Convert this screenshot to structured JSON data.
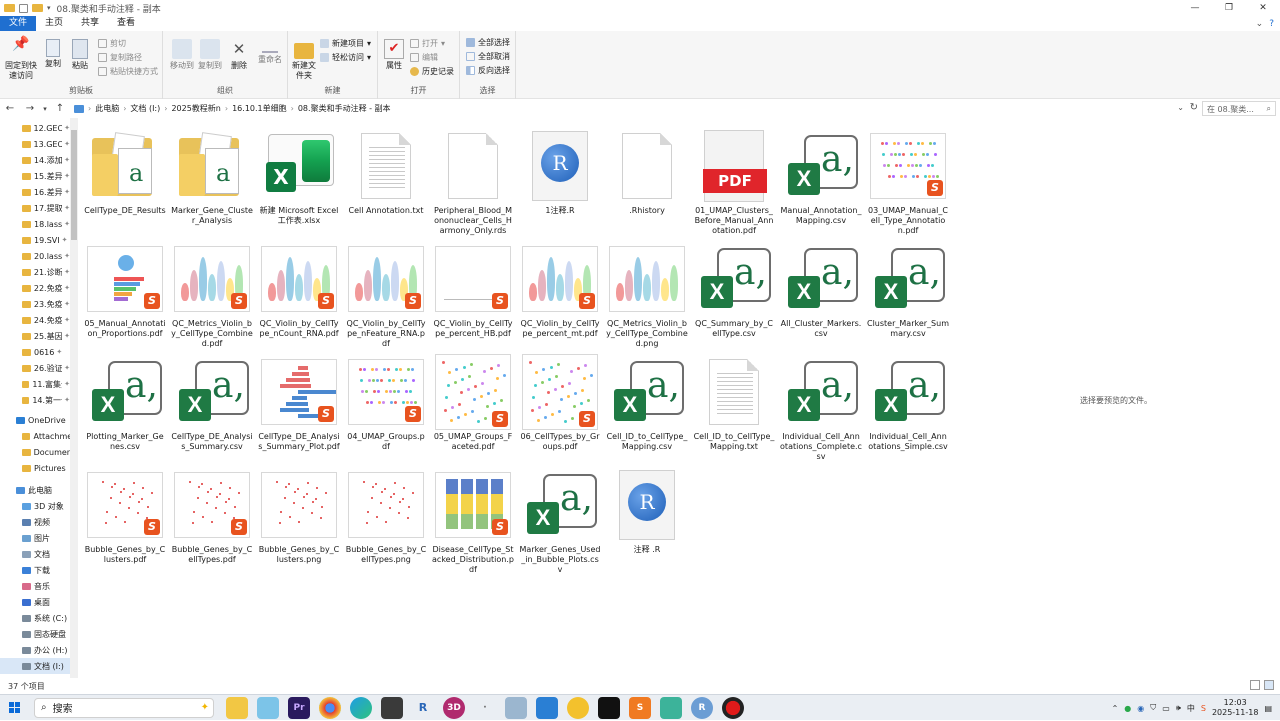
{
  "window": {
    "title": "08.聚类和手动注释 - 副本",
    "controls": [
      "—",
      "❐",
      "✕"
    ]
  },
  "ribbon_tabs": [
    "文件",
    "主页",
    "共享",
    "查看"
  ],
  "ribbon": {
    "clipboard": {
      "pin_label": "固定到快速访问",
      "copy_label": "复制",
      "paste_label": "粘贴",
      "cut_label": "剪切",
      "copypath_label": "复制路径",
      "pasteshortcut_label": "粘贴快捷方式",
      "group_label": "剪贴板"
    },
    "organize": {
      "moveto_label": "移动到",
      "copyto_label": "复制到",
      "delete_label": "删除",
      "rename_label": "重命名",
      "group_label": "组织"
    },
    "new": {
      "newfolder_label": "新建文件夹",
      "newitem_label": "新建项目",
      "easyaccess_label": "轻松访问",
      "group_label": "新建"
    },
    "open": {
      "properties_label": "属性",
      "open_label": "打开",
      "edit_label": "编辑",
      "history_label": "历史记录",
      "group_label": "打开"
    },
    "select": {
      "selectall_label": "全部选择",
      "selectnone_label": "全部取消",
      "invert_label": "反向选择",
      "group_label": "选择"
    }
  },
  "address": {
    "crumbs": [
      "此电脑",
      "文档 (I:)",
      "2025教程新n",
      "16.10.1单细胞",
      "08.聚类和手动注释 - 副本"
    ],
    "search_placeholder": "在 08.聚类..."
  },
  "nav": {
    "quick": [
      "12.GEO",
      "13.GEO",
      "14.添加",
      "15.差异",
      "16.差异",
      "17.提取",
      "18.lass",
      "19.SVI",
      "20.lass",
      "21.诊断",
      "22.免疫",
      "23.免疫",
      "24.免疫",
      "25.基因",
      "0616",
      "26.验证",
      "11.富集分",
      "14.第一个"
    ],
    "onedrive": "OneDrive",
    "onedrive_items": [
      "Attachme",
      "Documen",
      "Pictures"
    ],
    "thispc": "此电脑",
    "pc_items": [
      "3D 对象",
      "视频",
      "图片",
      "文档",
      "下载",
      "音乐",
      "桌面",
      "系统 (C:)",
      "固态硬盘",
      "办公 (H:)",
      "文档 (I:)"
    ]
  },
  "files": [
    {
      "name": "CellType_DE_Results",
      "icon": "folder"
    },
    {
      "name": "Marker_Gene_Cluster_Analysis",
      "icon": "folder"
    },
    {
      "name": "新建 Microsoft Excel 工作表.xlsx",
      "icon": "excel-new"
    },
    {
      "name": "Cell Annotation.txt",
      "icon": "text"
    },
    {
      "name": "Peripheral_Blood_Mononuclear_Cells_Harmony_Only.rds",
      "icon": "blank"
    },
    {
      "name": "1注释.R",
      "icon": "r"
    },
    {
      "name": ".Rhistory",
      "icon": "blank"
    },
    {
      "name": "01_UMAP_Clusters_Before_Manual_Annotation.pdf",
      "icon": "pdf"
    },
    {
      "name": "Manual_Annotation_Mapping.csv",
      "icon": "csv"
    },
    {
      "name": "03_UMAP_Manual_Cell_Type_Annotation.pdf",
      "icon": "umap-pdf"
    },
    {
      "name": "05_Manual_Annotation_Proportions.pdf",
      "icon": "prop-pdf"
    },
    {
      "name": "QC_Metrics_Violin_by_CellType_Combined.pdf",
      "icon": "violin-pdf"
    },
    {
      "name": "QC_Violin_by_CellType_nCount_RNA.pdf",
      "icon": "violin-pdf"
    },
    {
      "name": "QC_Violin_by_CellType_nFeature_RNA.pdf",
      "icon": "violin-pdf"
    },
    {
      "name": "QC_Violin_by_CellType_percent_HB.pdf",
      "icon": "blankplot-pdf"
    },
    {
      "name": "QC_Violin_by_CellType_percent_mt.pdf",
      "icon": "violin-pdf"
    },
    {
      "name": "QC_Metrics_Violin_by_CellType_Combined.png",
      "icon": "violin-png"
    },
    {
      "name": "QC_Summary_by_CellType.csv",
      "icon": "csv"
    },
    {
      "name": "All_Cluster_Markers.csv",
      "icon": "csv"
    },
    {
      "name": "Cluster_Marker_Summary.csv",
      "icon": "csv"
    },
    {
      "name": "Plotting_Marker_Genes.csv",
      "icon": "csv"
    },
    {
      "name": "CellType_DE_Analysis_Summary.csv",
      "icon": "csv"
    },
    {
      "name": "CellType_DE_Analysis_Summary_Plot.pdf",
      "icon": "barh-pdf"
    },
    {
      "name": "04_UMAP_Groups.pdf",
      "icon": "umap-pdf"
    },
    {
      "name": "05_UMAP_Groups_Faceted.pdf",
      "icon": "facet-pdf"
    },
    {
      "name": "06_CellTypes_by_Groups.pdf",
      "icon": "facet-pdf"
    },
    {
      "name": "Cell_ID_to_CellType_Mapping.csv",
      "icon": "csv"
    },
    {
      "name": "Cell_ID_to_CellType_Mapping.txt",
      "icon": "text"
    },
    {
      "name": "Individual_Cell_Annotations_Complete.csv",
      "icon": "csv"
    },
    {
      "name": "Individual_Cell_Annotations_Simple.csv",
      "icon": "csv"
    },
    {
      "name": "Bubble_Genes_by_Clusters.pdf",
      "icon": "bubble-pdf"
    },
    {
      "name": "Bubble_Genes_by_CellTypes.pdf",
      "icon": "bubble-pdf"
    },
    {
      "name": "Bubble_Genes_by_Clusters.png",
      "icon": "bubble-png"
    },
    {
      "name": "Bubble_Genes_by_CellTypes.png",
      "icon": "bubble-png"
    },
    {
      "name": "Disease_CellType_Stacked_Distribution.pdf",
      "icon": "stack-pdf"
    },
    {
      "name": "Marker_Genes_Used_in_Bubble_Plots.csv",
      "icon": "csv"
    },
    {
      "name": "注释 .R",
      "icon": "r"
    }
  ],
  "preview_hint": "选择要预览的文件。",
  "status": {
    "item_count": "37 个项目"
  },
  "taskbar": {
    "search_label": "搜索",
    "time": "12:03",
    "date": "2025-11-18",
    "lang": "中"
  }
}
